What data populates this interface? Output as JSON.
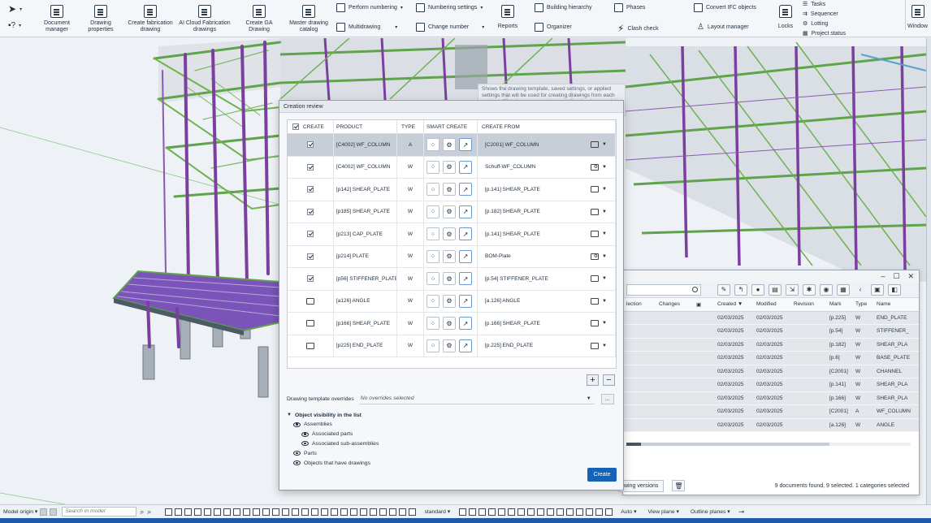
{
  "ribbon": {
    "big_buttons": [
      "Document manager",
      "Drawing properties",
      "Create fabrication drawing",
      "AI Cloud Fabrication drawings",
      "Create GA Drawing",
      "Master drawing catalog",
      "Reports"
    ],
    "small_buttons": {
      "perform_numbering": "Perform numbering",
      "numbering_settings": "Numbering settings",
      "multidrawing": "Multidrawing",
      "change_number": "Change number",
      "building_hierarchy": "Building hierarchy",
      "organizer": "Organizer",
      "phases": "Phases",
      "clash_check": "Clash check",
      "convert_ifc": "Convert IFC objects",
      "layout_manager": "Layout manager",
      "locks": "Locks",
      "tasks": "Tasks",
      "sequencer": "Sequencer",
      "lotting": "Lotting",
      "project_status": "Project status",
      "window": "Window"
    }
  },
  "tooltip": {
    "text": "Shows the drawing template, saved settings, or applied settings that will be used for creating drawings from each product. Click the arrow to select another drawing template or saved settings."
  },
  "dialog": {
    "title": "Creation review",
    "columns": [
      "CREATE",
      "PRODUCT",
      "TYPE",
      "SMART CREATE",
      "CREATE FROM"
    ],
    "rows": [
      {
        "checked": "yes",
        "product": "[C4002] WF_COLUMN",
        "type": "A",
        "from": "[C2001] WF_COLUMN",
        "selected": "yes"
      },
      {
        "checked": "yes",
        "product": "[C4002] WF_COLUMN",
        "type": "W",
        "from": "Schuff-WF_COLUMN"
      },
      {
        "checked": "yes",
        "product": "[p142] SHEAR_PLATE",
        "type": "W",
        "from": "[p.141] SHEAR_PLATE"
      },
      {
        "checked": "yes",
        "product": "[p185] SHEAR_PLATE",
        "type": "W",
        "from": "[p.182] SHEAR_PLATE"
      },
      {
        "checked": "yes",
        "product": "[p213] CAP_PLATE",
        "type": "W",
        "from": "[p.141] SHEAR_PLATE"
      },
      {
        "checked": "yes",
        "product": "[p214] PLATE",
        "type": "W",
        "from": "BOM-Plate"
      },
      {
        "checked": "yes",
        "product": "[p56] STIFFENER_PLATE",
        "type": "W",
        "from": "[p.54] STIFFENER_PLATE"
      },
      {
        "checked": "no",
        "product": "[a126] ANGLE",
        "type": "W",
        "from": "[a.126] ANGLE"
      },
      {
        "checked": "no",
        "product": "[p166] SHEAR_PLATE",
        "type": "W",
        "from": "[p.166] SHEAR_PLATE"
      },
      {
        "checked": "no",
        "product": "[p225] END_PLATE",
        "type": "W",
        "from": "[p.225] END_PLATE"
      }
    ],
    "add_label": "+",
    "remove_label": "−",
    "template_overrides_label": "Drawing template overrides",
    "template_overrides_value": "No overrides selected",
    "more_label": "...",
    "visibility": {
      "heading": "Object visibility in the list",
      "items": [
        "Assemblies",
        "Associated parts",
        "Associated sub-assemblies",
        "Parts",
        "Objects that have drawings"
      ]
    },
    "create_label": "Create"
  },
  "docmgr": {
    "columns": [
      "lection",
      "Changes",
      "",
      "Created ▼",
      "Modified",
      "Revision",
      "Mark",
      "Type",
      "Name"
    ],
    "rows": [
      {
        "created": "02/03/2025",
        "modified": "02/03/2025",
        "mark": "[p.225]",
        "type": "W",
        "name": "END_PLATE"
      },
      {
        "created": "02/03/2025",
        "modified": "02/03/2025",
        "mark": "[p.54]",
        "type": "W",
        "name": "STIFFENER_"
      },
      {
        "created": "02/03/2025",
        "modified": "02/03/2025",
        "mark": "[p.182]",
        "type": "W",
        "name": "SHEAR_PLA"
      },
      {
        "created": "02/03/2025",
        "modified": "02/03/2025",
        "mark": "[p.6]",
        "type": "W",
        "name": "BASE_PLATE"
      },
      {
        "created": "02/03/2025",
        "modified": "02/03/2025",
        "mark": "[C2001]",
        "type": "W",
        "name": "CHANNEL"
      },
      {
        "created": "02/03/2025",
        "modified": "02/03/2025",
        "mark": "[p.141]",
        "type": "W",
        "name": "SHEAR_PLA"
      },
      {
        "created": "02/03/2025",
        "modified": "02/03/2025",
        "mark": "[p.166]",
        "type": "W",
        "name": "SHEAR_PLA"
      },
      {
        "created": "02/03/2025",
        "modified": "02/03/2025",
        "mark": "[C2001]",
        "type": "A",
        "name": "WF_COLUMN"
      },
      {
        "created": "02/03/2025",
        "modified": "02/03/2025",
        "mark": "[a.126]",
        "type": "W",
        "name": "ANGLE"
      }
    ],
    "drawing_versions_label": "wing versions",
    "found_text": "9 documents found, 9 selected. 1 categories selected"
  },
  "statusbar": {
    "model_origin": "Model origin",
    "search_placeholder": "Search in model",
    "standard": "standard",
    "auto": "Auto",
    "view_plane": "View plane",
    "outline_planes": "Outline planes"
  },
  "colors": {
    "accent": "#1463b5",
    "steel_purple": "#7b3fa0",
    "steel_green": "#5fa34a",
    "steel_gray": "#9aa3ac"
  }
}
